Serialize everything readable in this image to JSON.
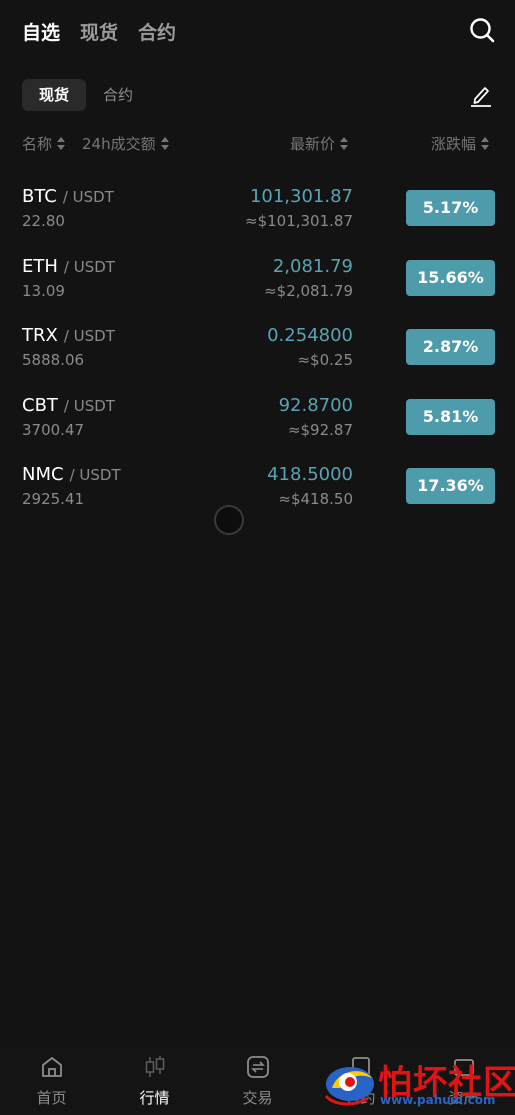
{
  "header": {
    "tabs": [
      {
        "label": "自选",
        "active": true
      },
      {
        "label": "现货",
        "active": false
      },
      {
        "label": "合约",
        "active": false
      }
    ]
  },
  "sub_tabs": [
    {
      "label": "现货",
      "active": true
    },
    {
      "label": "合约",
      "active": false
    }
  ],
  "columns": {
    "name": "名称",
    "volume": "24h成交额",
    "price": "最新价",
    "change": "涨跌幅"
  },
  "markets": [
    {
      "base": "BTC",
      "quote": "/ USDT",
      "volume": "22.80",
      "price": "101,301.87",
      "fiat": "≈$101,301.87",
      "change": "5.17%"
    },
    {
      "base": "ETH",
      "quote": "/ USDT",
      "volume": "13.09",
      "price": "2,081.79",
      "fiat": "≈$2,081.79",
      "change": "15.66%"
    },
    {
      "base": "TRX",
      "quote": "/ USDT",
      "volume": "5888.06",
      "price": "0.254800",
      "fiat": "≈$0.25",
      "change": "2.87%"
    },
    {
      "base": "CBT",
      "quote": "/ USDT",
      "volume": "3700.47",
      "price": "92.8700",
      "fiat": "≈$92.87",
      "change": "5.81%"
    },
    {
      "base": "NMC",
      "quote": "/ USDT",
      "volume": "2925.41",
      "price": "418.5000",
      "fiat": "≈$418.50",
      "change": "17.36%"
    }
  ],
  "bottom_nav": [
    {
      "label": "首页",
      "icon": "home-icon",
      "active": false
    },
    {
      "label": "行情",
      "icon": "market-icon",
      "active": true
    },
    {
      "label": "交易",
      "icon": "trade-icon",
      "active": false
    },
    {
      "label": "合约",
      "icon": "contract-icon",
      "active": false
    },
    {
      "label": "资产",
      "icon": "assets-icon",
      "active": false
    }
  ],
  "watermark": {
    "title": "怕坏社区",
    "url": "www.pahuai.com"
  },
  "colors": {
    "background": "#131313",
    "price": "#58a4b4",
    "change_badge": "#4e9cab"
  }
}
